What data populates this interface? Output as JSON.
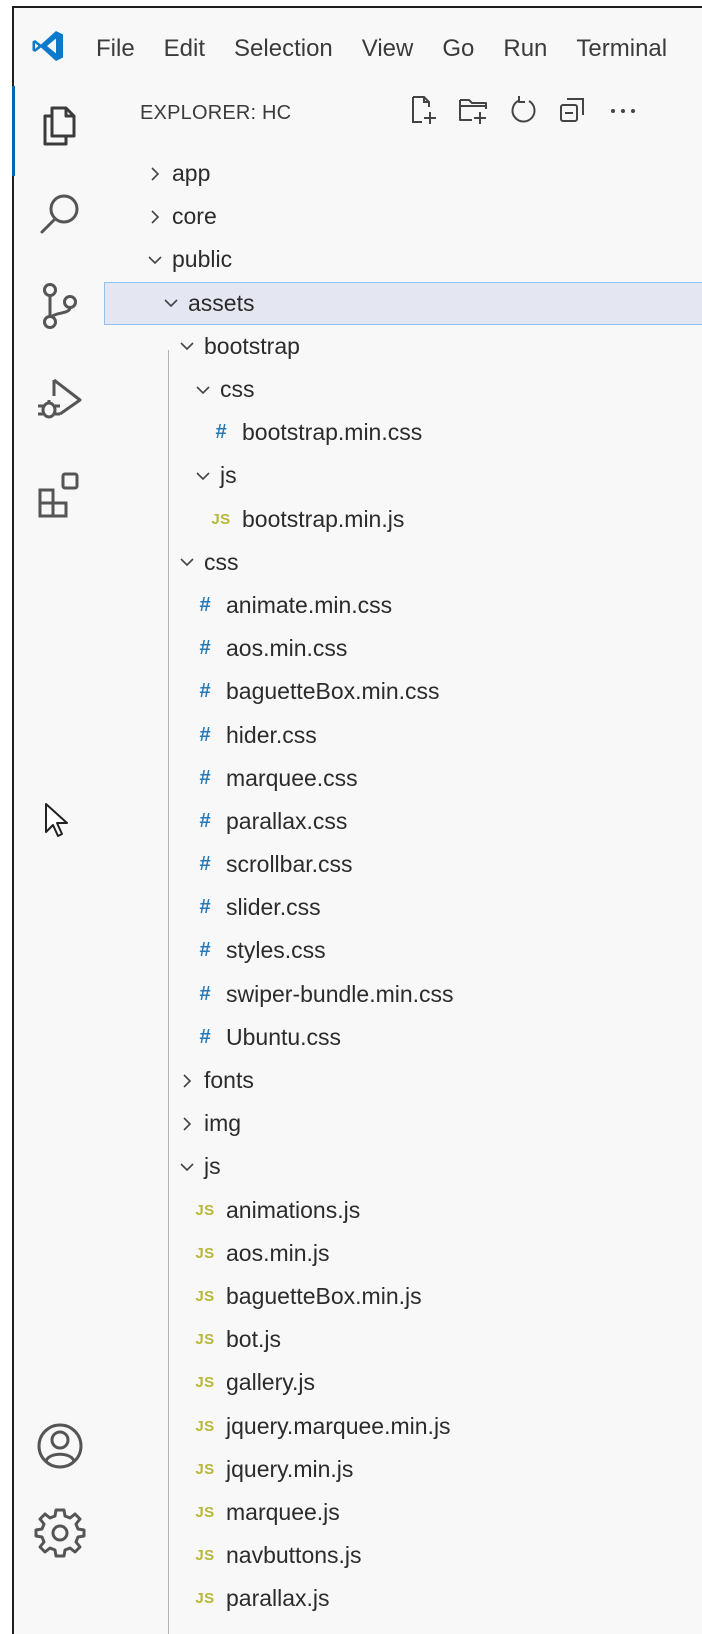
{
  "menu": [
    "File",
    "Edit",
    "Selection",
    "View",
    "Go",
    "Run",
    "Terminal"
  ],
  "activity_bar": {
    "icons": [
      "explorer-icon",
      "search-icon",
      "source-control-icon",
      "run-debug-icon",
      "extensions-icon",
      "account-icon",
      "settings-gear-icon"
    ]
  },
  "explorer": {
    "title": "EXPLORER: HC",
    "actions": [
      "new-file-icon",
      "new-folder-icon",
      "refresh-icon",
      "collapse-all-icon",
      "more-actions-icon"
    ]
  },
  "tree": [
    {
      "label": "app",
      "type": "folder",
      "expanded": false,
      "depth": 0
    },
    {
      "label": "core",
      "type": "folder",
      "expanded": false,
      "depth": 0
    },
    {
      "label": "public",
      "type": "folder",
      "expanded": true,
      "depth": 0
    },
    {
      "label": "assets",
      "type": "folder",
      "expanded": true,
      "depth": 1,
      "selected": true
    },
    {
      "label": "bootstrap",
      "type": "folder",
      "expanded": true,
      "depth": 2
    },
    {
      "label": "css",
      "type": "folder",
      "expanded": true,
      "depth": 3
    },
    {
      "label": "bootstrap.min.css",
      "type": "css",
      "depth": 4
    },
    {
      "label": "js",
      "type": "folder",
      "expanded": true,
      "depth": 3
    },
    {
      "label": "bootstrap.min.js",
      "type": "js",
      "depth": 4
    },
    {
      "label": "css",
      "type": "folder",
      "expanded": true,
      "depth": 2
    },
    {
      "label": "animate.min.css",
      "type": "css",
      "depth": 3
    },
    {
      "label": "aos.min.css",
      "type": "css",
      "depth": 3
    },
    {
      "label": "baguetteBox.min.css",
      "type": "css",
      "depth": 3
    },
    {
      "label": "hider.css",
      "type": "css",
      "depth": 3
    },
    {
      "label": "marquee.css",
      "type": "css",
      "depth": 3
    },
    {
      "label": "parallax.css",
      "type": "css",
      "depth": 3
    },
    {
      "label": "scrollbar.css",
      "type": "css",
      "depth": 3
    },
    {
      "label": "slider.css",
      "type": "css",
      "depth": 3
    },
    {
      "label": "styles.css",
      "type": "css",
      "depth": 3
    },
    {
      "label": "swiper-bundle.min.css",
      "type": "css",
      "depth": 3
    },
    {
      "label": "Ubuntu.css",
      "type": "css",
      "depth": 3
    },
    {
      "label": "fonts",
      "type": "folder",
      "expanded": false,
      "depth": 2
    },
    {
      "label": "img",
      "type": "folder",
      "expanded": false,
      "depth": 2
    },
    {
      "label": "js",
      "type": "folder",
      "expanded": true,
      "depth": 2
    },
    {
      "label": "animations.js",
      "type": "js",
      "depth": 3
    },
    {
      "label": "aos.min.js",
      "type": "js",
      "depth": 3
    },
    {
      "label": "baguetteBox.min.js",
      "type": "js",
      "depth": 3
    },
    {
      "label": "bot.js",
      "type": "js",
      "depth": 3
    },
    {
      "label": "gallery.js",
      "type": "js",
      "depth": 3
    },
    {
      "label": "jquery.marquee.min.js",
      "type": "js",
      "depth": 3
    },
    {
      "label": "jquery.min.js",
      "type": "js",
      "depth": 3
    },
    {
      "label": "marquee.js",
      "type": "js",
      "depth": 3
    },
    {
      "label": "navbuttons.js",
      "type": "js",
      "depth": 3
    },
    {
      "label": "parallax.js",
      "type": "js",
      "depth": 3
    }
  ],
  "icon_text": {
    "css": "#",
    "js": "JS"
  },
  "colors": {
    "accent": "#0066b8",
    "css_icon": "#267ab8",
    "js_icon": "#b7b73b",
    "selection_bg": "#e4e6f1",
    "selection_border": "#90c1ef"
  }
}
